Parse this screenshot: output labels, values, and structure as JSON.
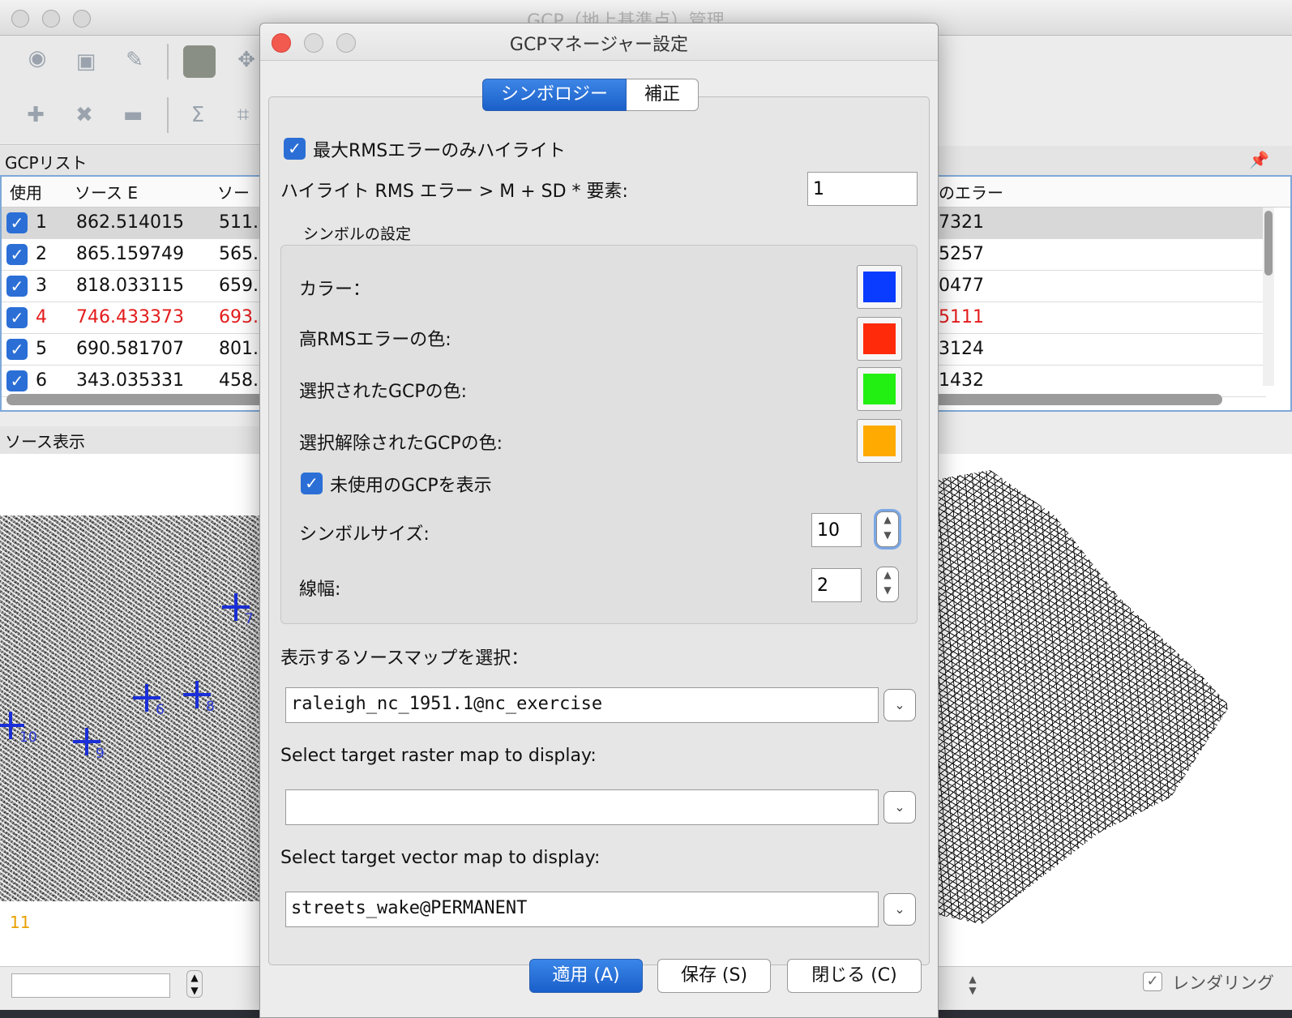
{
  "bg_window": {
    "title": "GCP（地上基準点）管理",
    "gcp_list_label": "GCPリスト",
    "columns": [
      "使用",
      "ソース E",
      "ソー",
      "のエラー"
    ],
    "rows": [
      {
        "num": "1",
        "e": "862.514015",
        "n": "511.",
        "err": "7321",
        "selected": true,
        "highlight": false
      },
      {
        "num": "2",
        "e": "865.159749",
        "n": "565.",
        "err": "5257",
        "selected": false,
        "highlight": false
      },
      {
        "num": "3",
        "e": "818.033115",
        "n": "659.",
        "err": "0477",
        "selected": false,
        "highlight": false
      },
      {
        "num": "4",
        "e": "746.433373",
        "n": "693.",
        "err": "5111",
        "selected": false,
        "highlight": true
      },
      {
        "num": "5",
        "e": "690.581707",
        "n": "801.",
        "err": "3124",
        "selected": false,
        "highlight": false
      },
      {
        "num": "6",
        "e": "343.035331",
        "n": "458.",
        "err": "1432",
        "selected": false,
        "highlight": false
      }
    ],
    "source_display_label": "ソース表示",
    "map_marker_numbers": [
      "7",
      "6",
      "8",
      "10",
      "9"
    ],
    "orange_number": "11",
    "render_label": "レンダリング"
  },
  "dialog": {
    "title": "GCPマネージャー設定",
    "tabs": [
      "シンボロジー",
      "補正"
    ],
    "highlight_max_rms_label": "最大RMSエラーのみハイライト",
    "highlight_max_rms_checked": true,
    "highlight_factor_label": "ハイライト RMS エラー > M + SD * 要素:",
    "highlight_factor_value": "1",
    "symbol_settings_label": "シンボルの設定",
    "color_label": "カラー：",
    "color_value": "#0a3cff",
    "high_rms_color_label": "高RMSエラーの色:",
    "high_rms_color_value": "#ff2a0a",
    "selected_gcp_color_label": "選択されたGCPの色:",
    "selected_gcp_color_value": "#22f012",
    "unselected_gcp_color_label": "選択解除されたGCPの色:",
    "unselected_gcp_color_value": "#ffaa00",
    "show_unused_label": "未使用のGCPを表示",
    "show_unused_checked": true,
    "symbol_size_label": "シンボルサイズ:",
    "symbol_size_value": "10",
    "line_width_label": "線幅:",
    "line_width_value": "2",
    "source_map_label": "表示するソースマップを選択：",
    "source_map_value": "raleigh_nc_1951.1@nc_exercise",
    "target_raster_label": "Select target raster map to display:",
    "target_raster_value": "",
    "target_vector_label": "Select target vector map to display:",
    "target_vector_value": "streets_wake@PERMANENT",
    "apply_label": "適用 (A)",
    "save_label": "保存 (S)",
    "close_label": "閉じる (C)"
  }
}
